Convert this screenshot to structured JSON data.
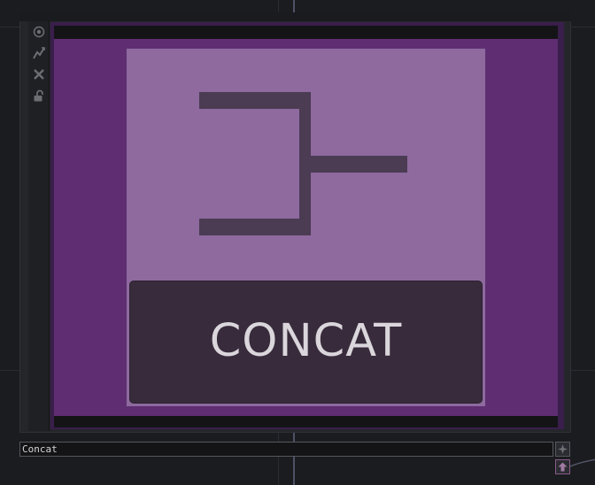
{
  "node": {
    "name_value": "Concat",
    "operator_label": "CONCAT",
    "family_color": "#5f2e72",
    "tile_color": "#8e6a9f",
    "glyph_color": "#4b3b53"
  },
  "toolbar": {
    "items": [
      {
        "icon": "viewer-eye-icon"
      },
      {
        "icon": "cook-lightning-icon"
      },
      {
        "icon": "bypass-x-icon"
      },
      {
        "icon": "lock-icon"
      }
    ]
  },
  "corner_buttons": [
    {
      "icon": "display-flag-icon"
    },
    {
      "icon": "render-flag-icon"
    }
  ]
}
